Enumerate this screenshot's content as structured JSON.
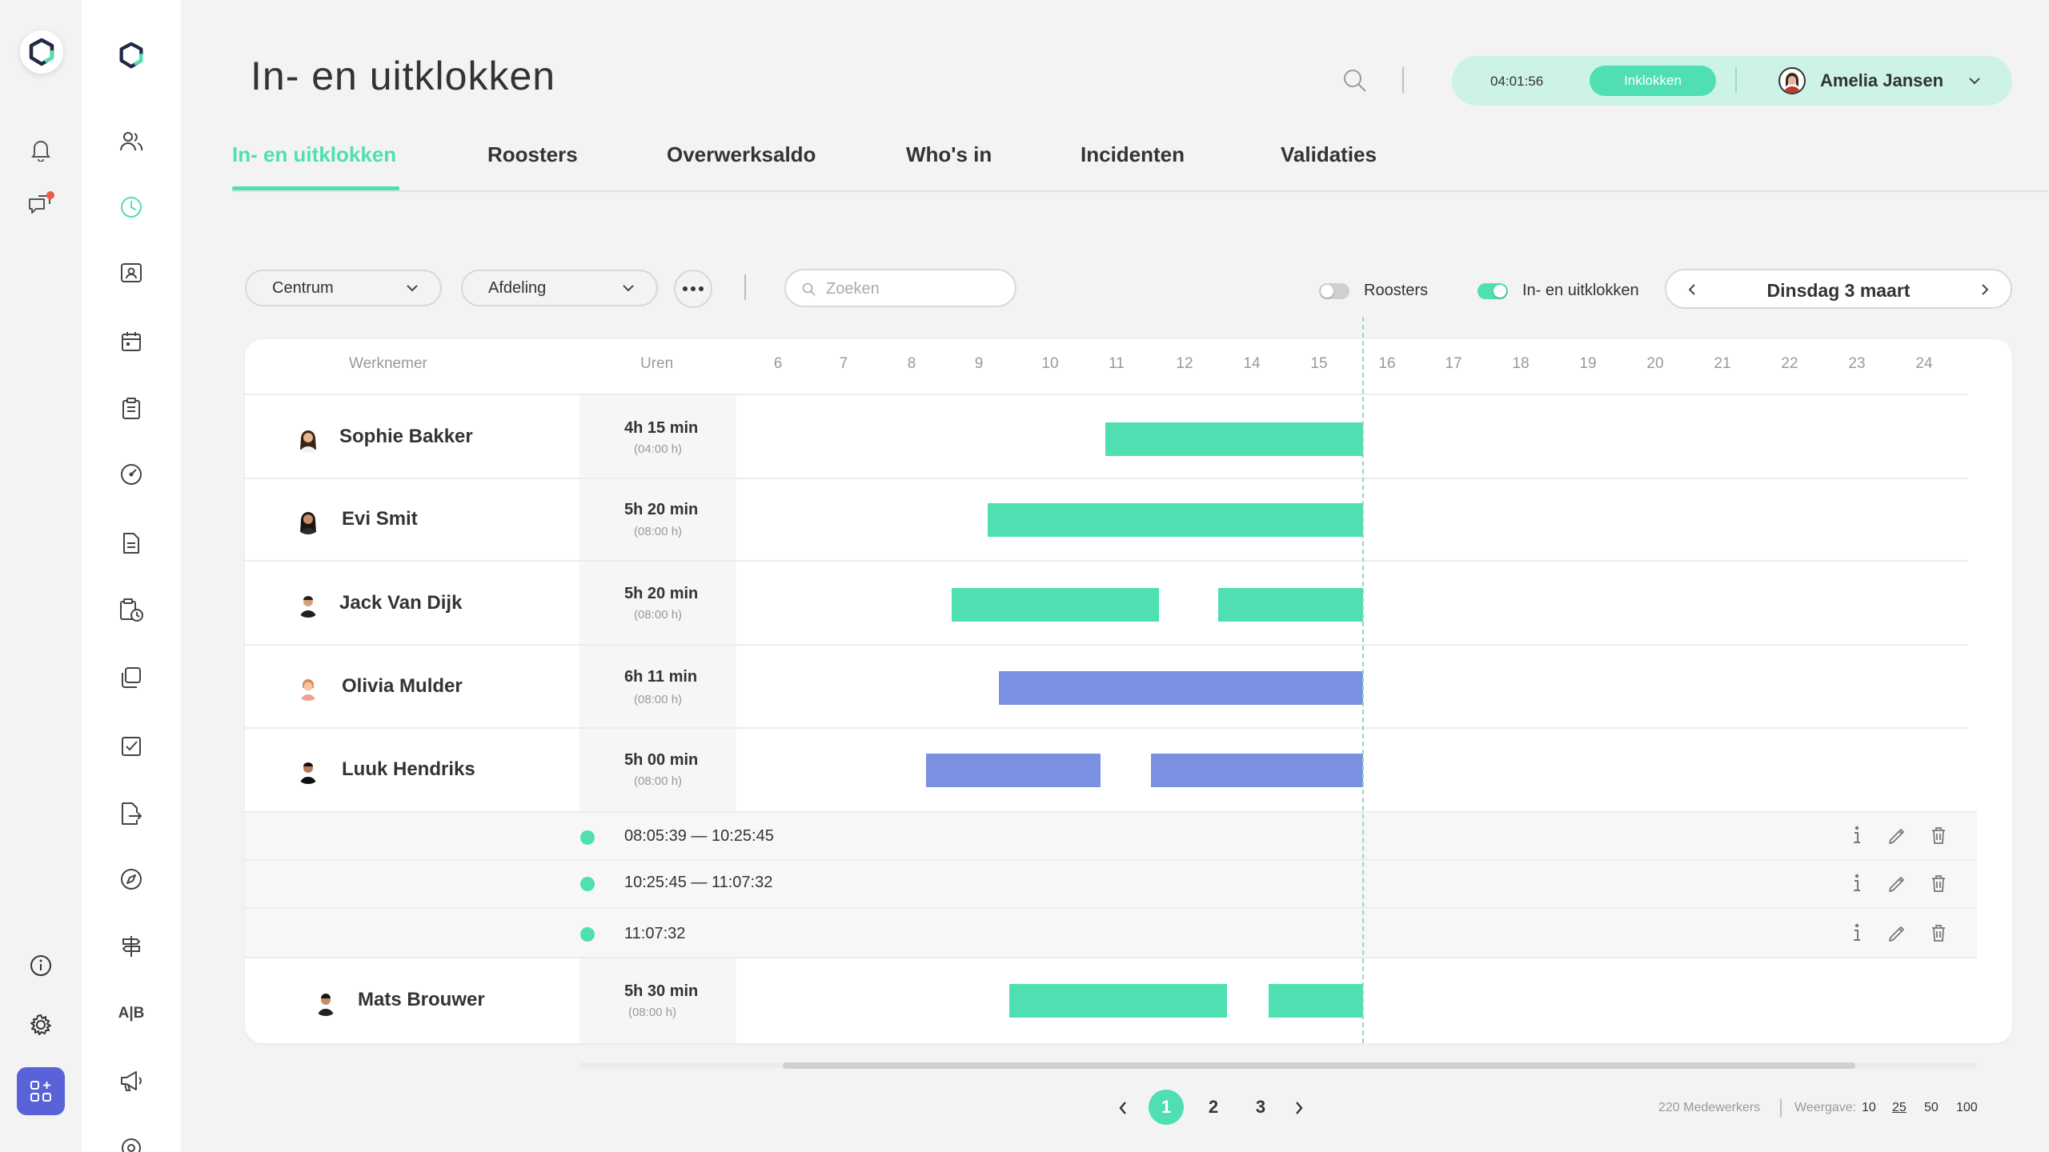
{
  "app": {
    "title": "In- en uitklokken",
    "accent_color": "#4fdfb2",
    "shift_blue_color": "#7a90e0"
  },
  "rail1": {
    "icons": [
      "logo-icon",
      "bell-icon",
      "chat-notification-icon",
      "info-icon",
      "gear-icon",
      "apps-plus-icon"
    ]
  },
  "rail2": {
    "icons": [
      "logo-icon",
      "users-icon",
      "clock-icon",
      "badge-icon",
      "calendar-icon",
      "clipboard-icon",
      "gauge-icon",
      "document-icon",
      "clipboard-clock-icon",
      "copy-icon",
      "checkbox-icon",
      "document-export-icon",
      "compass-icon",
      "signpost-icon",
      "ab-test-icon",
      "megaphone-icon",
      "settings-partial-icon"
    ],
    "ab_label": "A|B"
  },
  "header": {
    "timer": "04:01:56",
    "clockin_label": "Inklokken",
    "user_name": "Amelia Jansen"
  },
  "tabs": [
    {
      "label": "In- en uitklokken",
      "active": true
    },
    {
      "label": "Roosters",
      "active": false
    },
    {
      "label": "Overwerksaldo",
      "active": false
    },
    {
      "label": "Who's in",
      "active": false
    },
    {
      "label": "Incidenten",
      "active": false
    },
    {
      "label": "Validaties",
      "active": false
    }
  ],
  "filters": {
    "location": "Centrum",
    "department": "Afdeling",
    "search_placeholder": "Zoeken",
    "toggle_schedules": {
      "label": "Roosters",
      "on": false
    },
    "toggle_clock": {
      "label": "In- en uitklokken",
      "on": true
    },
    "date": "Dinsdag 3 maart"
  },
  "table": {
    "col_employee": "Werknemer",
    "col_hours": "Uren",
    "hour_ticks": [
      "6",
      "7",
      "8",
      "9",
      "10",
      "11",
      "12",
      "14",
      "15",
      "16",
      "17",
      "18",
      "19",
      "20",
      "21",
      "22",
      "23",
      "24"
    ],
    "rows": [
      {
        "name": "Sophie Bakker",
        "hours": "4h 15 min",
        "planned": "(04:00 h)"
      },
      {
        "name": "Evi Smit",
        "hours": "5h 20 min",
        "planned": "(08:00 h)"
      },
      {
        "name": "Jack Van Dijk",
        "hours": "5h 20 min",
        "planned": "(08:00 h)"
      },
      {
        "name": "Olivia Mulder",
        "hours": "6h 11 min",
        "planned": "(08:00 h)"
      },
      {
        "name": "Luuk Hendriks",
        "hours": "5h 00 min",
        "planned": "(08:00 h)"
      },
      {
        "name": "Mats Brouwer",
        "hours": "5h 30 min",
        "planned": "(08:00 h)"
      }
    ],
    "details": [
      {
        "time": "08:05:39 — 10:25:45"
      },
      {
        "time": "10:25:45 — 11:07:32"
      },
      {
        "time": "11:07:32"
      }
    ]
  },
  "pagination": {
    "pages": [
      "1",
      "2",
      "3"
    ],
    "current": "1",
    "total_label": "220 Medewerkers",
    "view_label": "Weergave:",
    "view_options": [
      "10",
      "25",
      "50",
      "100"
    ],
    "view_selected": "25"
  }
}
